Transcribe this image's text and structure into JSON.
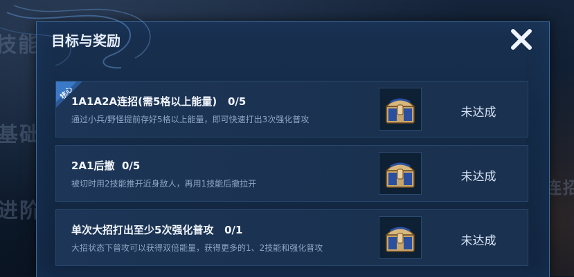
{
  "dialog": {
    "title": "目标与奖励",
    "close_icon": "close-icon"
  },
  "background": {
    "texts": [
      "技能",
      "基础",
      "进阶",
      "连招"
    ]
  },
  "tasks": [
    {
      "tag": "核心",
      "title": "1A1A2A连招(需5格以上能量)",
      "progress": "0/5",
      "description": "通过小兵/野怪提前存好5格以上能量，即可快速打出3次强化普攻",
      "reward_icon": "treasure-chest-icon",
      "status": "未达成"
    },
    {
      "title": "2A1后撤",
      "progress": "0/5",
      "description": "被切时用2技能推开近身敌人，再用1技能后撤拉开",
      "reward_icon": "treasure-chest-icon",
      "status": "未达成"
    },
    {
      "title": "单次大招打出至少5次强化普攻",
      "progress": "0/1",
      "description": "大招状态下普攻可以获得双倍能量，获得更多的1、2技能和强化普攻",
      "reward_icon": "treasure-chest-icon",
      "status": "未达成"
    }
  ],
  "colors": {
    "panel": "#142a46",
    "row": "#1d3556",
    "accent_blue": "#3d6a9a",
    "tag_blue": "#3a78c8"
  }
}
